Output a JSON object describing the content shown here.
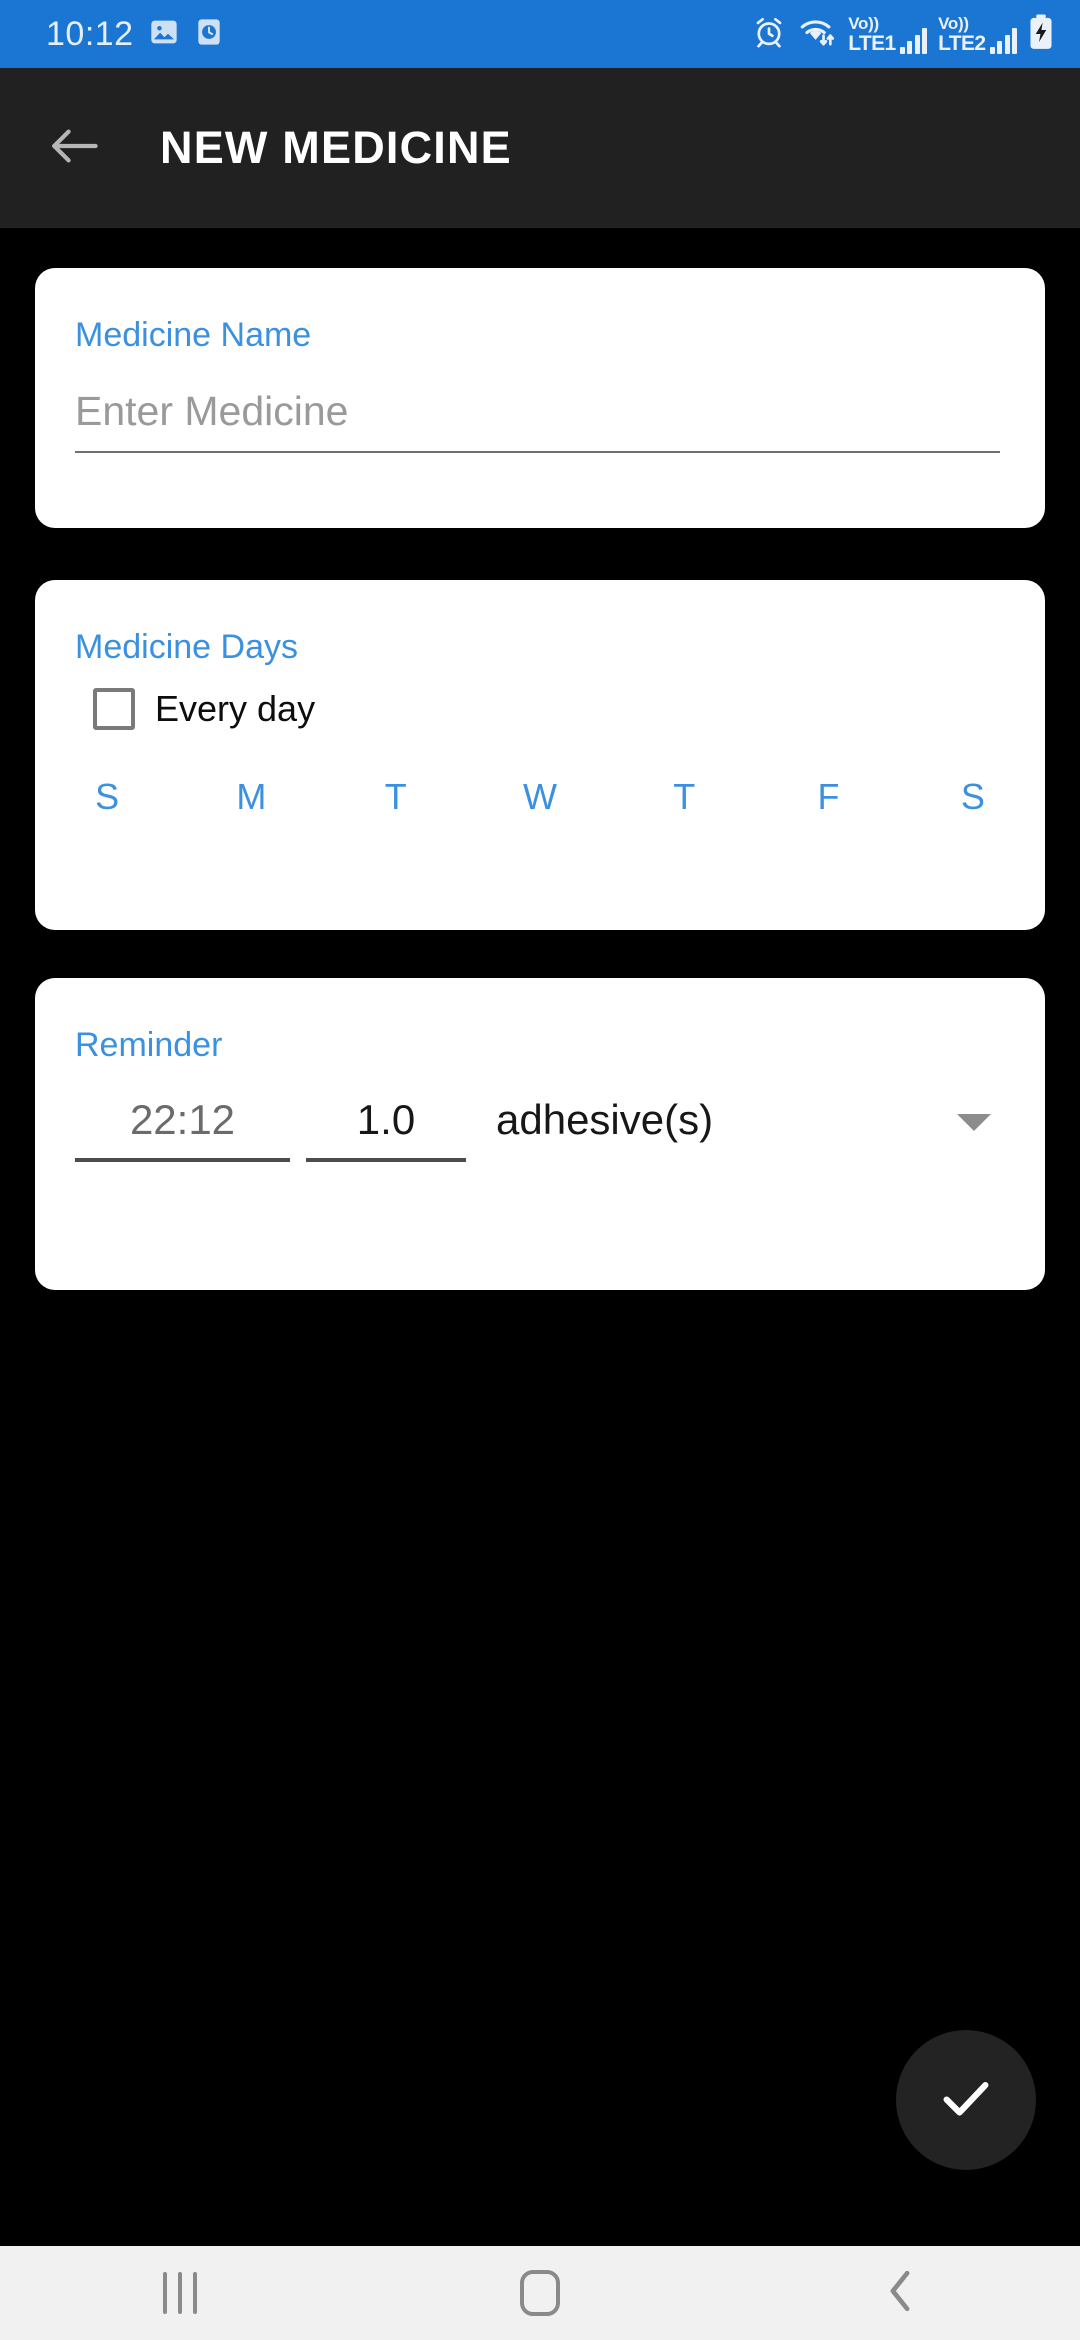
{
  "status_bar": {
    "time": "10:12",
    "background_color": "#1a76d2",
    "left_icons": [
      "image-icon",
      "clock-badge-icon"
    ],
    "right_icons": [
      "alarm-icon",
      "wifi-data-icon",
      "signal-bars-icon",
      "signal-bars-icon",
      "battery-charging-icon"
    ],
    "sim1_label_top": "Vo))",
    "sim1_label_bottom": "LTE1",
    "sim2_label_top": "Vo))",
    "sim2_label_bottom": "LTE2"
  },
  "app_bar": {
    "title": "NEW MEDICINE",
    "back_icon": "arrow-left-icon",
    "background_color": "#212121"
  },
  "theme": {
    "accent_blue": "#3b91e0",
    "page_background": "#000000",
    "card_background": "#ffffff"
  },
  "medicine_name_card": {
    "label": "Medicine Name",
    "input_value": "",
    "input_placeholder": "Enter Medicine"
  },
  "medicine_days_card": {
    "label": "Medicine Days",
    "everyday_label": "Every day",
    "everyday_checked": false,
    "days": [
      {
        "letter": "S",
        "name": "sunday",
        "selected": false
      },
      {
        "letter": "M",
        "name": "monday",
        "selected": false
      },
      {
        "letter": "T",
        "name": "tuesday",
        "selected": false
      },
      {
        "letter": "W",
        "name": "wednesday",
        "selected": false
      },
      {
        "letter": "T",
        "name": "thursday",
        "selected": false
      },
      {
        "letter": "F",
        "name": "friday",
        "selected": false
      },
      {
        "letter": "S",
        "name": "saturday",
        "selected": false
      }
    ]
  },
  "reminder_card": {
    "label": "Reminder",
    "time_value": "22:12",
    "dose_value": "1.0",
    "unit_value": "adhesive(s)",
    "dropdown_icon": "chevron-down-icon"
  },
  "fab": {
    "icon": "check-icon",
    "background_color": "#232323"
  },
  "nav_bar": {
    "recents_icon": "recents-icon",
    "home_icon": "home-icon",
    "back_icon": "chevron-left-icon",
    "background_color": "#f1f1f1"
  }
}
